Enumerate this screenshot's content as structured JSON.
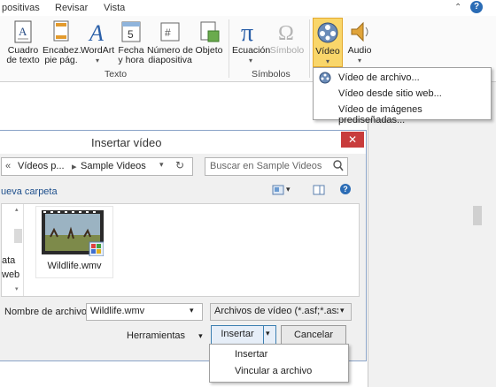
{
  "tabs": [
    "positivas",
    "Revisar",
    "Vista"
  ],
  "ribbon": {
    "buttons": [
      {
        "label1": "Cuadro",
        "label2": "de texto"
      },
      {
        "label1": "Encabez.",
        "label2": "pie pág."
      },
      {
        "label1": "WordArt",
        "label2": ""
      },
      {
        "label1": "Fecha",
        "label2": "y hora"
      },
      {
        "label1": "Número de",
        "label2": "diapositiva"
      },
      {
        "label1": "Objeto",
        "label2": ""
      },
      {
        "label1": "Ecuación",
        "label2": ""
      },
      {
        "label1": "Símbolo",
        "label2": ""
      },
      {
        "label1": "Vídeo",
        "label2": ""
      },
      {
        "label1": "Audio",
        "label2": ""
      }
    ],
    "groups": {
      "texto": "Texto",
      "simbolos": "Símbolos"
    },
    "date_icon_number": "5",
    "pi_glyph": "π",
    "omega_glyph": "Ω"
  },
  "video_menu": {
    "items": [
      "Vídeo de archivo...",
      "Vídeo desde sitio web...",
      "Vídeo de imágenes prediseñadas..."
    ]
  },
  "dialog": {
    "title": "Insertar vídeo",
    "close": "✕",
    "breadcrumb_back": "«",
    "breadcrumb_1": "Vídeos p...",
    "breadcrumb_sep": "▸",
    "breadcrumb_2": "Sample Videos",
    "search_placeholder": "Buscar en Sample Videos",
    "new_folder": "ueva carpeta",
    "left_items": [
      "ata",
      "web"
    ],
    "file": {
      "name": "Wildlife.wmv"
    },
    "filename_label": "Nombre de archivo:",
    "filename_value": "Wildlife.wmv",
    "filetype_value": "Archivos de vídeo (*.asf;*.asx;*.",
    "tools_label": "Herramientas",
    "insert_label": "Insertar",
    "cancel_label": "Cancelar"
  },
  "insert_menu": {
    "items": [
      "Insertar",
      "Vincular a archivo"
    ]
  },
  "colors": {
    "accent": "#2b6cb5",
    "close": "#c83c3c",
    "video_highlight": "#f9d66a"
  }
}
